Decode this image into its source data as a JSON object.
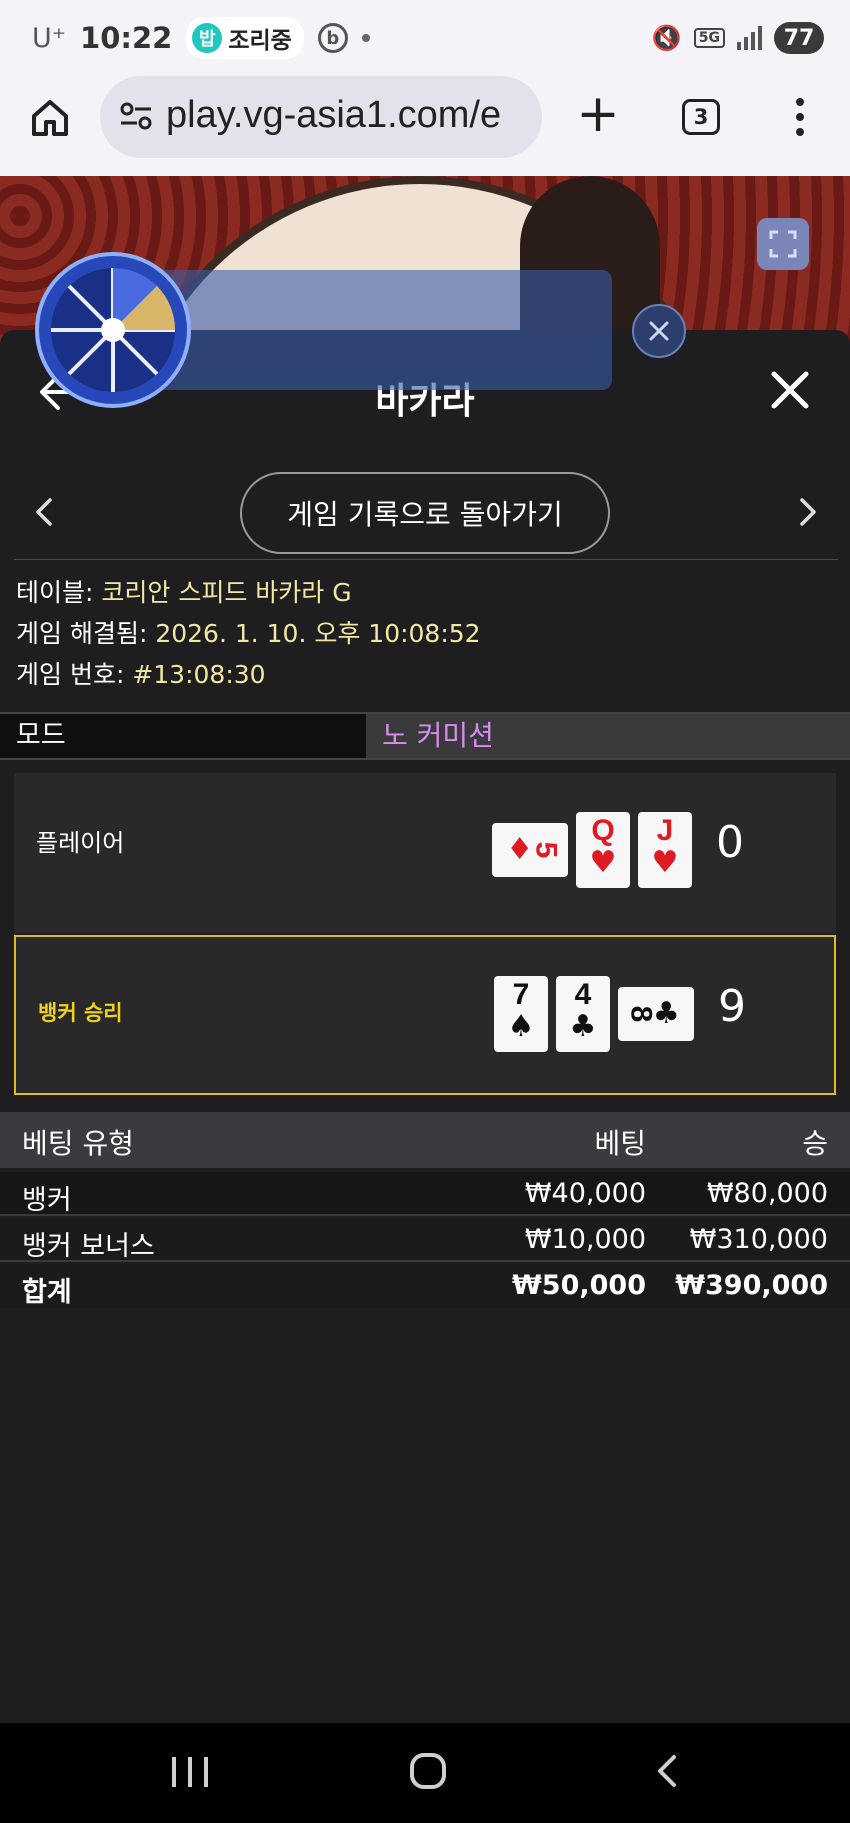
{
  "status_bar": {
    "carrier": "U⁺",
    "time": "10:22",
    "notification_label": "조리중",
    "notification_badge": "밥",
    "network": "5G",
    "battery": "77"
  },
  "browser": {
    "url": "play.vg-asia1.com/e",
    "tab_count": "3"
  },
  "panel": {
    "title": "바카라",
    "back_to_records": "게임 기록으로 돌아가기",
    "info": {
      "table_label": "테이블: ",
      "table_value": "코리안 스피드 바카라 G",
      "resolved_label": "게임 해결됨: ",
      "resolved_value": "2026. 1. 10. 오후 10:08:52",
      "game_no_label": "게임 번호: ",
      "game_no_value": "#13:08:30"
    },
    "mode": {
      "label": "모드",
      "value": "노 커미션"
    },
    "player": {
      "label": "플레이어",
      "score": "0",
      "cards": [
        {
          "rank": "5",
          "suit": "♦",
          "color": "red",
          "sideways": true
        },
        {
          "rank": "Q",
          "suit": "♥",
          "color": "red",
          "sideways": false
        },
        {
          "rank": "J",
          "suit": "♥",
          "color": "red",
          "sideways": false
        }
      ]
    },
    "banker": {
      "label": "뱅커 승리",
      "score": "9",
      "cards": [
        {
          "rank": "7",
          "suit": "♠",
          "color": "black",
          "sideways": false
        },
        {
          "rank": "4",
          "suit": "♣",
          "color": "black",
          "sideways": false
        },
        {
          "rank": "8",
          "suit": "♣",
          "color": "black",
          "sideways": true
        }
      ]
    },
    "bets": {
      "headers": [
        "베팅 유형",
        "베팅",
        "승"
      ],
      "rows": [
        {
          "type": "뱅커",
          "bet": "₩40,000",
          "win": "₩80,000"
        },
        {
          "type": "뱅커 보너스",
          "bet": "₩10,000",
          "win": "₩310,000"
        },
        {
          "type": "합계",
          "bet": "₩50,000",
          "win": "₩390,000"
        }
      ]
    }
  },
  "colors": {
    "accent_yellow": "#f0d21a",
    "mode_value": "#d98cf0",
    "info_value": "#f3e7a2"
  }
}
